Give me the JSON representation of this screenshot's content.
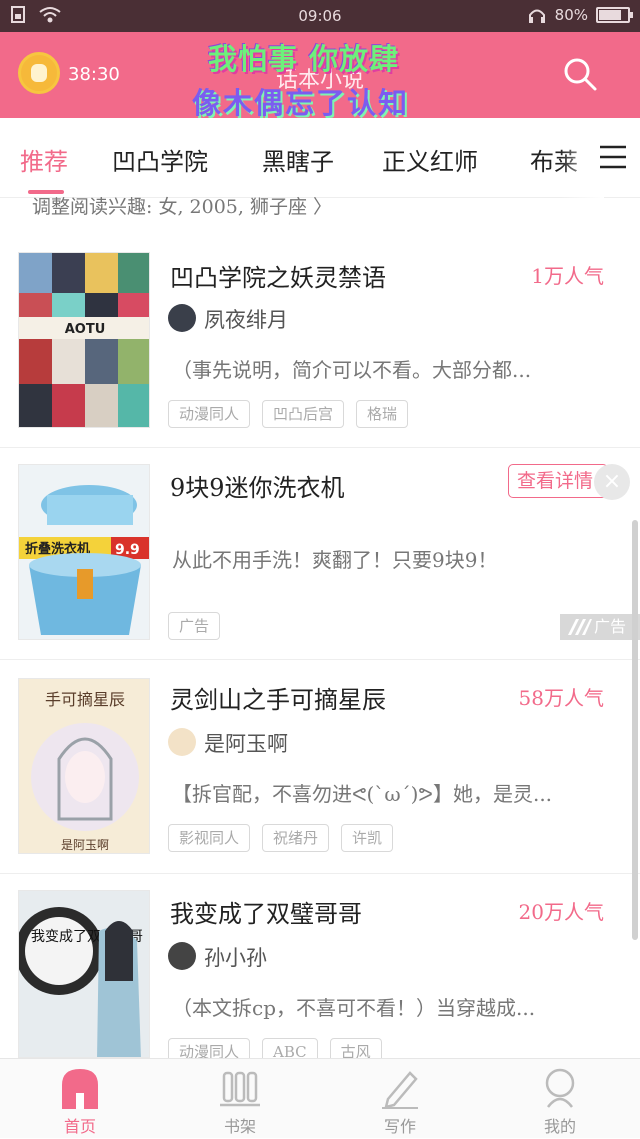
{
  "status_bar": {
    "time": "09:06",
    "battery": "80%",
    "battery_level": 0.8
  },
  "header": {
    "timer": "38:30",
    "app_title": "话本小说",
    "overlay_line1": "我怕事 你放肆",
    "overlay_line2": "像木偶忘了认知"
  },
  "tabs": [
    {
      "label": "推荐",
      "active": true
    },
    {
      "label": "凹凸学院"
    },
    {
      "label": "黑瞎子"
    },
    {
      "label": "正义红师"
    },
    {
      "label": "布莱"
    }
  ],
  "prefs_text": "调整阅读兴趣: 女, 2005, 狮子座 〉",
  "cards": [
    {
      "title": "凹凸学院之妖灵禁语",
      "popularity": "1万人气",
      "author": "夙夜绯月",
      "description": "（事先说明，简介可以不看。大部分都...",
      "tags": [
        "动漫同人",
        "凹凸后宫",
        "格瑞"
      ]
    },
    {
      "title": "9块9迷你洗衣机",
      "button": "查看详情",
      "description": "从此不用手洗！爽翻了！只要9块9！",
      "tags": [
        "广告"
      ],
      "ad_badge": "广告",
      "cover_banner": "折叠洗衣机",
      "cover_price": "9.9"
    },
    {
      "title": "灵剑山之手可摘星辰",
      "popularity": "58万人气",
      "author": "是阿玉啊",
      "description": "【拆官配，不喜勿进ᕙ(`ω´)ᕗ】她，是灵...",
      "tags": [
        "影视同人",
        "祝绪丹",
        "许凯"
      ],
      "cover_title": "手可摘星辰",
      "cover_sub": "是阿玉啊"
    },
    {
      "title": "我变成了双璧哥哥",
      "popularity": "20万人气",
      "author": "孙小孙",
      "description": "（本文拆cp，不喜可不看！）当穿越成...",
      "tags": [
        "动漫同人",
        "ABC",
        "古风"
      ],
      "cover_text": "我变成了双璧哥哥"
    }
  ],
  "bottom_nav": [
    {
      "label": "首页",
      "icon": "home-icon",
      "active": true
    },
    {
      "label": "书架",
      "icon": "bookshelf-icon"
    },
    {
      "label": "写作",
      "icon": "pen-icon"
    },
    {
      "label": "我的",
      "icon": "profile-icon"
    }
  ],
  "colors": {
    "accent": "#f26a8a",
    "status_bar": "#4a2f35"
  }
}
